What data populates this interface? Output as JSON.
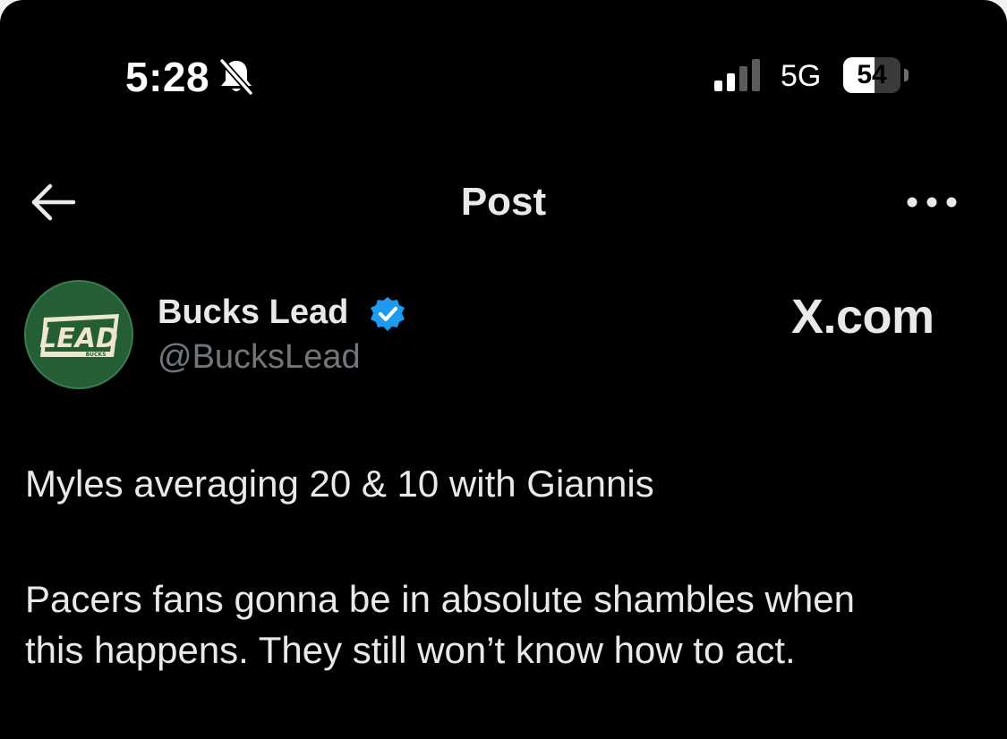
{
  "status_bar": {
    "time": "5:28",
    "network": "5G",
    "battery_level": "54",
    "battery_fraction": 0.54,
    "icons": [
      "bell-slash-icon",
      "signal-icon",
      "battery-icon"
    ]
  },
  "nav": {
    "title": "Post",
    "icons": [
      "back-arrow-icon",
      "more-icon"
    ]
  },
  "post": {
    "author_name": "Bucks Lead",
    "handle": "@BucksLead",
    "verified": true,
    "verified_color": "#1d9bf0",
    "avatar": {
      "logo_text": "LEAD",
      "logo_subtext": "BUCKS",
      "background_color": "#255d34",
      "accent_color": "#efe6cf"
    },
    "watermark": "X.com",
    "paragraphs": [
      [
        "Myles averaging 20 & 10 with Giannis"
      ],
      [
        "Pacers fans gonna be in absolute shambles when",
        "this happens. They still won’t know how to act."
      ]
    ]
  },
  "colors": {
    "background": "#000000",
    "text_primary": "#e7e9ea",
    "text_secondary": "#71767b"
  }
}
